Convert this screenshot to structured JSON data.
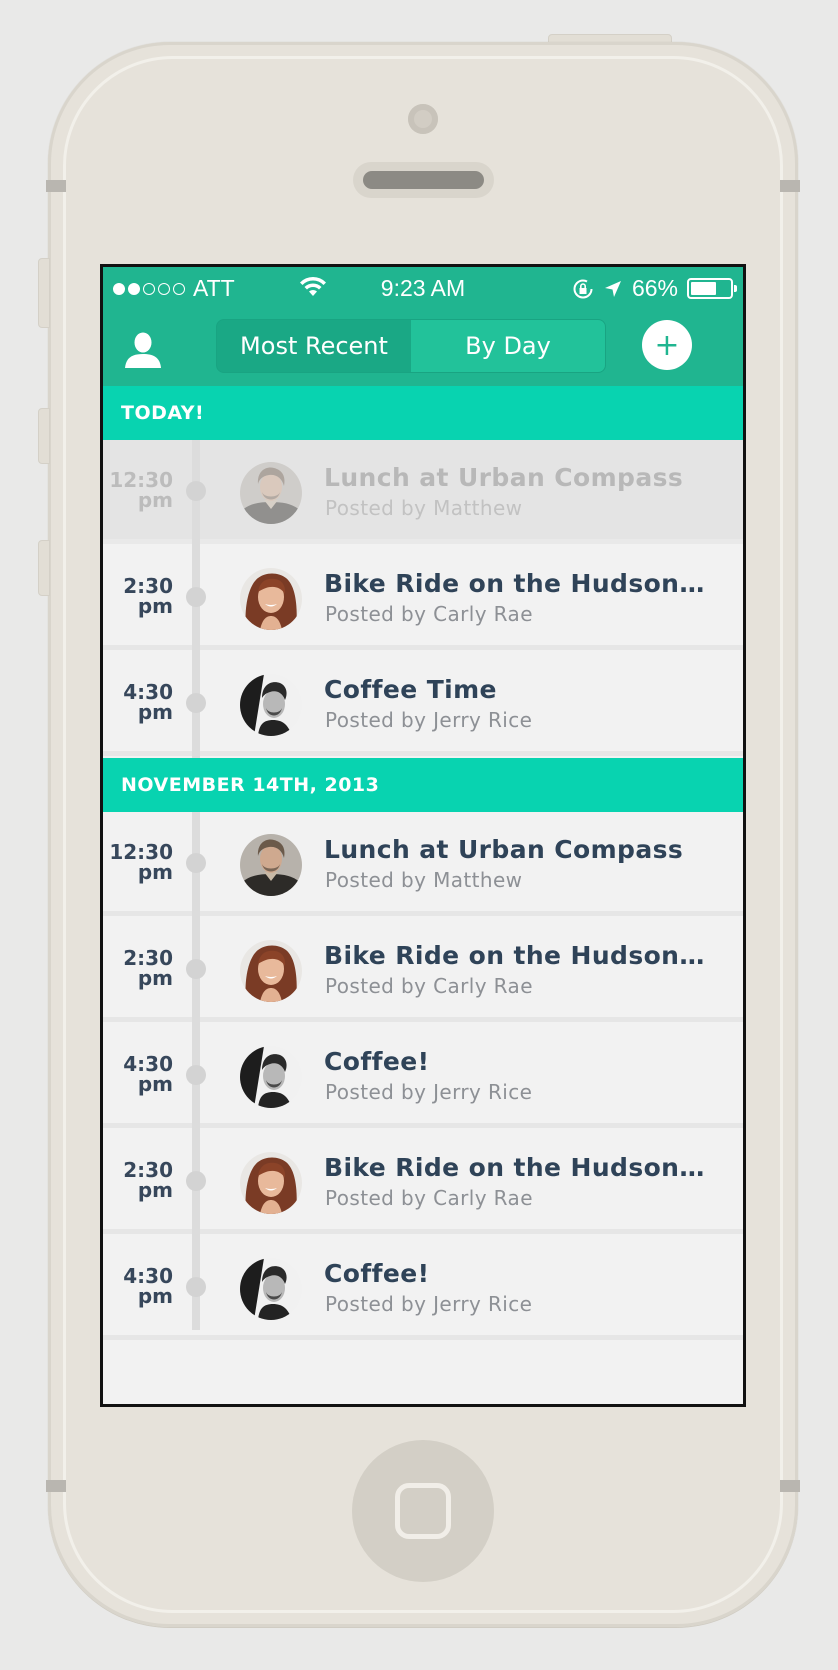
{
  "statusbar": {
    "carrier": "ATT",
    "signal_filled": 2,
    "signal_total": 5,
    "time": "9:23 AM",
    "battery": "66%",
    "battery_level": 0.66
  },
  "nav": {
    "profile_icon": "person-icon",
    "tabs": [
      {
        "label": "Most Recent",
        "active": false
      },
      {
        "label": "By Day",
        "active": true
      }
    ],
    "add_label": "+"
  },
  "sections": [
    {
      "title": "TODAY!",
      "items": [
        {
          "time": "12:30",
          "ampm": "pm",
          "title": "Lunch at Urban Compass",
          "subtitle": "Posted by Matthew",
          "avatar": "matthew",
          "dimmed": true
        },
        {
          "time": "2:30",
          "ampm": "pm",
          "title": "Bike Ride on the Hudson…",
          "subtitle": "Posted by Carly Rae",
          "avatar": "carly",
          "dimmed": false
        },
        {
          "time": "4:30",
          "ampm": "pm",
          "title": "Coffee Time",
          "subtitle": "Posted by Jerry Rice",
          "avatar": "jerry",
          "dimmed": false
        }
      ]
    },
    {
      "title": "NOVEMBER 14TH, 2013",
      "items": [
        {
          "time": "12:30",
          "ampm": "pm",
          "title": "Lunch at Urban Compass",
          "subtitle": "Posted by Matthew",
          "avatar": "matthew",
          "dimmed": false
        },
        {
          "time": "2:30",
          "ampm": "pm",
          "title": "Bike Ride on the Hudson…",
          "subtitle": "Posted by Carly Rae",
          "avatar": "carly",
          "dimmed": false
        },
        {
          "time": "4:30",
          "ampm": "pm",
          "title": "Coffee!",
          "subtitle": "Posted by Jerry Rice",
          "avatar": "jerry",
          "dimmed": false
        },
        {
          "time": "2:30",
          "ampm": "pm",
          "title": "Bike Ride on the Hudson…",
          "subtitle": "Posted by Carly Rae",
          "avatar": "carly",
          "dimmed": false
        },
        {
          "time": "4:30",
          "ampm": "pm",
          "title": "Coffee!",
          "subtitle": "Posted by Jerry Rice",
          "avatar": "jerry",
          "dimmed": false
        }
      ]
    }
  ],
  "colors": {
    "header": "#20b590",
    "section": "#08d3b0",
    "title_text": "#2f4358",
    "subtitle_text": "#8d9095"
  }
}
